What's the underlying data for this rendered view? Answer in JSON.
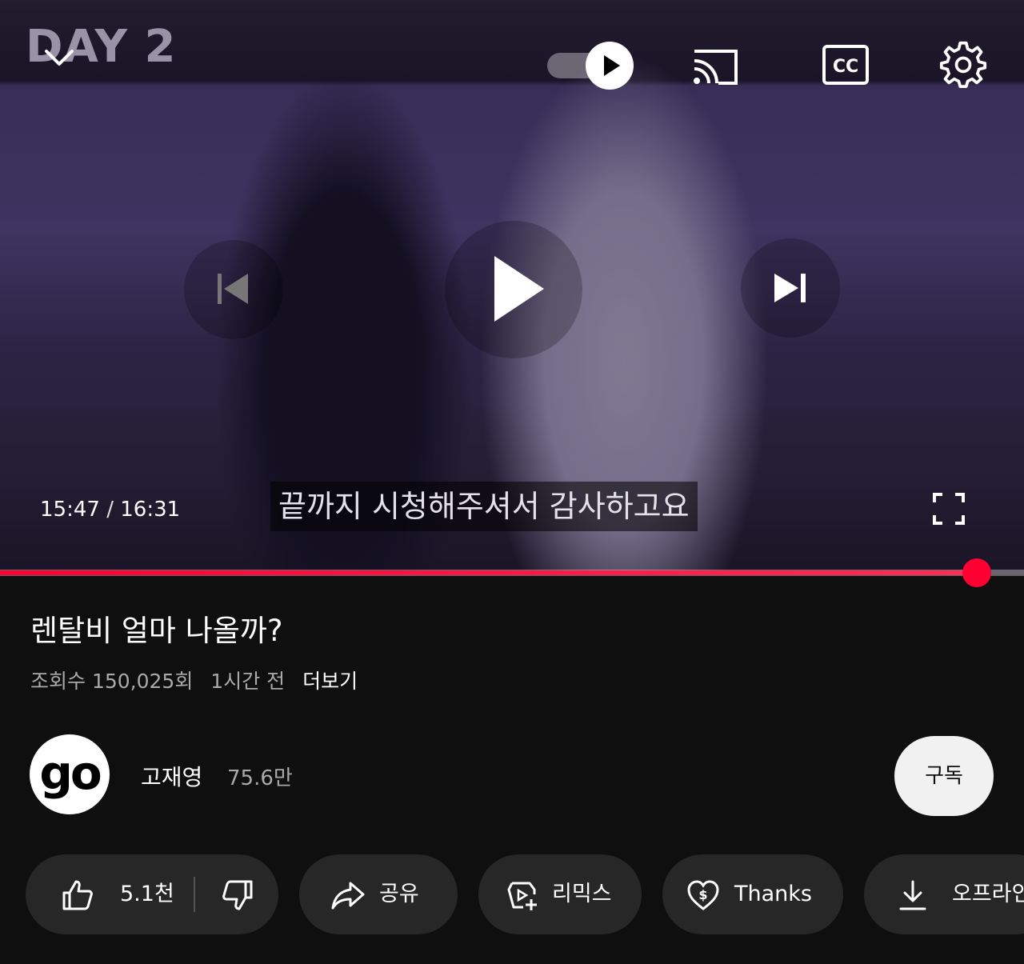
{
  "player": {
    "overlay_label": "DAY 2",
    "subtitle": "끝까지 시청해주셔서 감사하고요",
    "current_time": "15:47",
    "separator": "/",
    "duration": "16:31",
    "progress_fraction": 0.954,
    "accent_color": "#ff0033"
  },
  "video": {
    "title": "렌탈비 얼마 나올까?",
    "views": "조회수 150,025회",
    "age": "1시간 전",
    "more_label": "더보기"
  },
  "channel": {
    "avatar_text": "go",
    "name": "고재영",
    "subscribers": "75.6만",
    "subscribe_label": "구독"
  },
  "actions": {
    "like_count": "5.1천",
    "share_label": "공유",
    "remix_label": "리믹스",
    "thanks_label": "Thanks",
    "offline_label": "오프라인"
  },
  "icons": [
    "chevron-down-icon",
    "autoplay-play-icon",
    "cast-icon",
    "captions-icon",
    "settings-icon",
    "previous-icon",
    "play-icon",
    "next-icon",
    "fullscreen-icon",
    "like-icon",
    "dislike-icon",
    "share-icon",
    "remix-icon",
    "thanks-icon",
    "download-icon"
  ]
}
